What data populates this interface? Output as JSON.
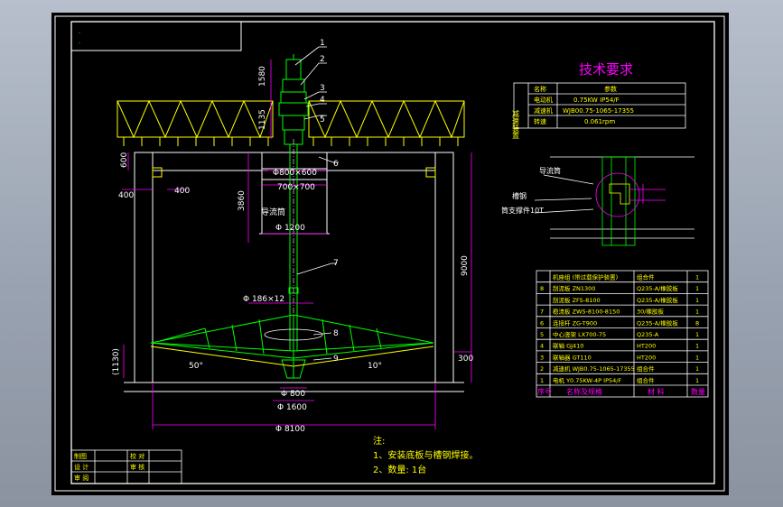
{
  "tech_requirements": {
    "title": "技术要求",
    "side_label": "减速装置",
    "rows": [
      {
        "name": "名称",
        "value": "参数"
      },
      {
        "name": "电动机",
        "value": "0.75KW   IP54/F"
      },
      {
        "name": "减速机",
        "value": "WJB00.75-1065-17355"
      },
      {
        "name": "转速",
        "value": "0.061rpm"
      }
    ]
  },
  "detail": {
    "label_cylinder": "导流筒",
    "label_plate": "槽钢",
    "label_support": "筒支撑件10T"
  },
  "parts": {
    "header": {
      "no": "序号",
      "name": "名称及规格",
      "material": "材 料",
      "qty": "数量"
    },
    "rows": [
      {
        "no": "",
        "name": "机座组 (带过载保护装置)",
        "material": "组合件",
        "qty": "1"
      },
      {
        "no": "8",
        "name": "刮泥板 ZN1300",
        "material": "Q235-A/橡胶板",
        "qty": "1"
      },
      {
        "no": "",
        "name": "刮泥板 ZFS-8100",
        "material": "Q235-A/橡胶板",
        "qty": "1"
      },
      {
        "no": "7",
        "name": "稳流板 ZWS-8100-8150",
        "material": "30/橡胶板",
        "qty": "1"
      },
      {
        "no": "6",
        "name": "连接杆 ZG-T900",
        "material": "Q235-A/橡胶板",
        "qty": "8"
      },
      {
        "no": "5",
        "name": "中心竖架 LX700-75",
        "material": "Q235-A",
        "qty": "1"
      },
      {
        "no": "4",
        "name": "联轴 GJ410",
        "material": "HT200",
        "qty": "1"
      },
      {
        "no": "3",
        "name": "联轴器 GT110",
        "material": "HT200",
        "qty": "1"
      },
      {
        "no": "2",
        "name": "减速机 WJB0.75-1065-17355",
        "material": "组合件",
        "qty": "1"
      },
      {
        "no": "1",
        "name": "电机 Y0.75KW-4P IP54/F",
        "material": "组合件",
        "qty": "1"
      }
    ]
  },
  "notes": {
    "title": "注:",
    "line1": "1、安装底板与槽钢焊接。",
    "line2": "2、数量: 1台"
  },
  "title_block": {
    "cells": [
      "制图",
      "",
      "校 对",
      "",
      "设 计",
      "",
      "审 核",
      "",
      "审 阅",
      "",
      "",
      ""
    ]
  },
  "dimensions": {
    "d_top": "1580",
    "d_1135": "1135",
    "d_600": "600",
    "d_400a": "400",
    "d_400b": "400",
    "d_3860": "3860",
    "d_800": "Φ800×600",
    "d_700": "700×700",
    "label_cyl": "导流筒",
    "d_1200": "Φ 1200",
    "d_9000": "9000",
    "d_shaft": "Φ 186×12",
    "a_50": "50°",
    "a_10": "10°",
    "d_1130": "(1130)",
    "d_300": "300",
    "d_800b": "Φ 800",
    "d_1600": "Φ 1600",
    "d_8100": "Φ 8100"
  },
  "balloons": [
    "1",
    "2",
    "3",
    "4",
    "5",
    "6",
    "7",
    "8",
    "9"
  ],
  "colors": {
    "frame": "#ffffff",
    "steel": "#ffff00",
    "dim": "#ff00ff",
    "part": "#00ff00",
    "leader": "#ffffff",
    "title": "#ff00ff"
  }
}
